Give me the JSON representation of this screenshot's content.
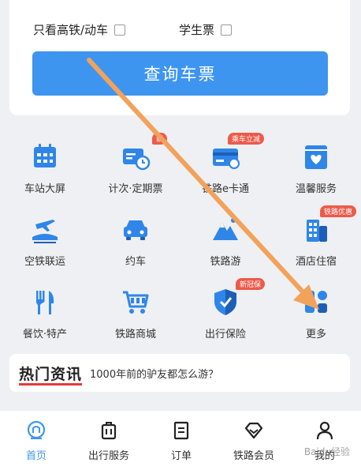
{
  "search": {
    "gaotie_label": "只看高铁/动车",
    "student_label": "学生票",
    "query_button": "查询车票"
  },
  "services": [
    {
      "label": "车站大屏",
      "icon": "station-screen-icon",
      "badge": ""
    },
    {
      "label": "计次·定期票",
      "icon": "ticket-card-icon",
      "badge": "新"
    },
    {
      "label": "铁路e卡通",
      "icon": "e-card-icon",
      "badge": "乘车立减"
    },
    {
      "label": "温馨服务",
      "icon": "heart-bag-icon",
      "badge": ""
    },
    {
      "label": "空铁联运",
      "icon": "plane-train-icon",
      "badge": ""
    },
    {
      "label": "约车",
      "icon": "car-icon",
      "badge": ""
    },
    {
      "label": "铁路游",
      "icon": "mountain-icon",
      "badge": ""
    },
    {
      "label": "酒店住宿",
      "icon": "hotel-icon",
      "badge": "铁路优惠"
    },
    {
      "label": "餐饮·特产",
      "icon": "fork-knife-icon",
      "badge": ""
    },
    {
      "label": "铁路商城",
      "icon": "shopping-cart-icon",
      "badge": ""
    },
    {
      "label": "出行保险",
      "icon": "shield-icon",
      "badge": "新冠保"
    },
    {
      "label": "更多",
      "icon": "more-grid-icon",
      "badge": ""
    }
  ],
  "news": {
    "tag": "热门资讯",
    "text": "1000年前的驴友都怎么游？"
  },
  "tabs": [
    {
      "label": "首页",
      "icon": "home-icon",
      "active": true
    },
    {
      "label": "出行服务",
      "icon": "luggage-icon",
      "active": false
    },
    {
      "label": "订单",
      "icon": "order-icon",
      "active": false
    },
    {
      "label": "铁路会员",
      "icon": "diamond-icon",
      "active": false
    },
    {
      "label": "我的",
      "icon": "user-icon",
      "active": false
    }
  ],
  "watermark": "Baidu经验",
  "colors": {
    "accent": "#3d95f0",
    "badge": "#ee5a4a",
    "arrow": "#f2a25a"
  }
}
